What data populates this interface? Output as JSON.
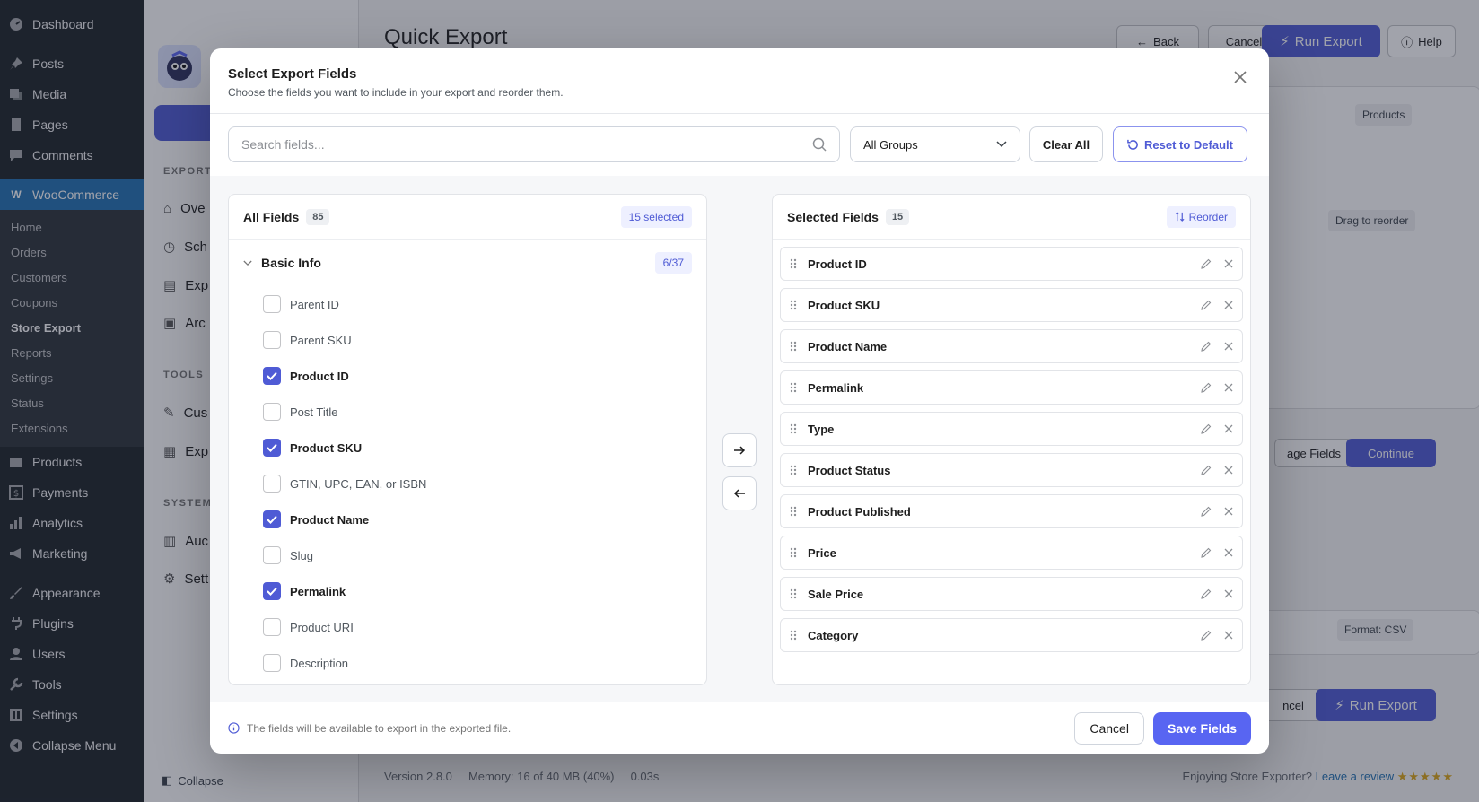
{
  "wp_menu": {
    "top": [
      {
        "label": "Dashboard",
        "icon": "dashboard-icon"
      },
      {
        "label": "Posts",
        "icon": "pin-icon"
      },
      {
        "label": "Media",
        "icon": "media-icon"
      },
      {
        "label": "Pages",
        "icon": "page-icon"
      },
      {
        "label": "Comments",
        "icon": "comment-icon"
      }
    ],
    "woo": {
      "label": "WooCommerce",
      "icon": "woo-icon"
    },
    "woo_sub": [
      "Home",
      "Orders",
      "Customers",
      "Coupons",
      "Store Export",
      "Reports",
      "Settings",
      "Status",
      "Extensions"
    ],
    "bottom": [
      {
        "label": "Products",
        "icon": "box-icon"
      },
      {
        "label": "Payments",
        "icon": "dollar-icon"
      },
      {
        "label": "Analytics",
        "icon": "bar-chart-icon"
      },
      {
        "label": "Marketing",
        "icon": "megaphone-icon"
      },
      {
        "label": "Appearance",
        "icon": "brush-icon"
      },
      {
        "label": "Plugins",
        "icon": "plug-icon"
      },
      {
        "label": "Users",
        "icon": "user-icon"
      },
      {
        "label": "Tools",
        "icon": "wrench-icon"
      },
      {
        "label": "Settings",
        "icon": "settings-icon"
      },
      {
        "label": "Collapse Menu",
        "icon": "collapse-icon"
      }
    ]
  },
  "plugin_nav": {
    "section_export": "EXPORT",
    "export_links": [
      "Ove",
      "Sch",
      "Exp",
      "Arc"
    ],
    "section_tools": "TOOLS",
    "tools_links": [
      "Cus",
      "Exp"
    ],
    "section_system": "SYSTEM",
    "system_links": [
      "Auc",
      "Sett"
    ],
    "collapse": "Collapse"
  },
  "page": {
    "title": "Quick Export",
    "back": "Back",
    "cancel": "Cancel",
    "run_export": "Run Export",
    "help": "Help",
    "pill_products": "Products",
    "drag_to_reorder": "Drag to reorder",
    "manage_fields_partial": "age Fields",
    "continue": "Continue",
    "format": "Format: CSV",
    "cancel_partial": "ncel",
    "run_export_bottom": "Run Export"
  },
  "footer": {
    "version": "Version 2.8.0",
    "memory": "Memory: 16 of 40 MB (40%)",
    "time": "0.03s",
    "enjoying": "Enjoying Store Exporter?",
    "review": "Leave a review",
    "stars": "★★★★★"
  },
  "modal": {
    "title": "Select Export Fields",
    "subtitle": "Choose the fields you want to include in your export and reorder them.",
    "search_placeholder": "Search fields...",
    "group_select": "All Groups",
    "clear_all": "Clear All",
    "reset_default": "Reset to Default",
    "all_fields": {
      "title": "All Fields",
      "count": "85",
      "selected_badge": "15 selected",
      "group": {
        "name": "Basic Info",
        "count": "6/37"
      },
      "fields": [
        {
          "label": "Parent ID",
          "checked": false
        },
        {
          "label": "Parent SKU",
          "checked": false
        },
        {
          "label": "Product ID",
          "checked": true
        },
        {
          "label": "Post Title",
          "checked": false
        },
        {
          "label": "Product SKU",
          "checked": true
        },
        {
          "label": "GTIN, UPC, EAN, or ISBN",
          "checked": false
        },
        {
          "label": "Product Name",
          "checked": true
        },
        {
          "label": "Slug",
          "checked": false
        },
        {
          "label": "Permalink",
          "checked": true
        },
        {
          "label": "Product URI",
          "checked": false
        },
        {
          "label": "Description",
          "checked": false
        }
      ]
    },
    "selected_fields": {
      "title": "Selected Fields",
      "count": "15",
      "reorder": "Reorder",
      "items": [
        "Product ID",
        "Product SKU",
        "Product Name",
        "Permalink",
        "Type",
        "Product Status",
        "Product Published",
        "Price",
        "Sale Price",
        "Category"
      ]
    },
    "footer_note": "The fields will be available to export in the exported file.",
    "cancel": "Cancel",
    "save": "Save Fields"
  },
  "colors": {
    "accent": "#5865f2",
    "wp_admin": "#1d2327",
    "wp_active": "#2271b1"
  }
}
